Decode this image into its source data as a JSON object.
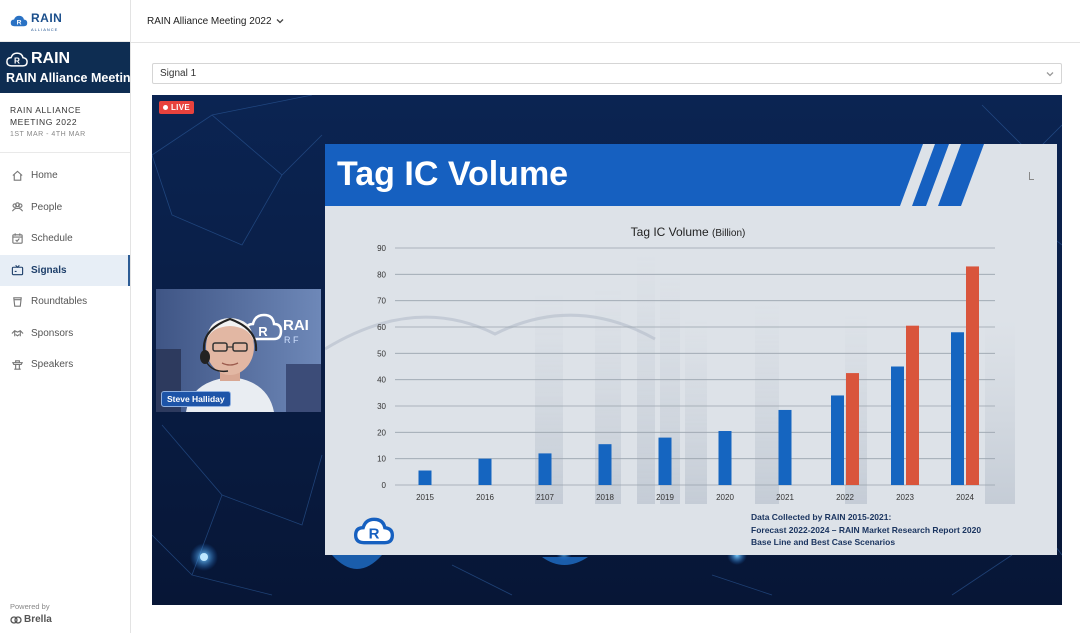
{
  "brand": {
    "logo_word": "RAIN",
    "logo_sub": "ALLIANCE",
    "banner_title": "RAIN Alliance Meeting"
  },
  "event": {
    "name": "RAIN ALLIANCE MEETING 2022",
    "dates": "1ST MAR - 4TH MAR"
  },
  "nav": [
    {
      "label": "Home",
      "icon": "home-icon"
    },
    {
      "label": "People",
      "icon": "people-icon"
    },
    {
      "label": "Schedule",
      "icon": "calendar-icon"
    },
    {
      "label": "Signals",
      "icon": "tv-icon",
      "active": true
    },
    {
      "label": "Roundtables",
      "icon": "cup-icon"
    },
    {
      "label": "Sponsors",
      "icon": "handshake-icon"
    },
    {
      "label": "Speakers",
      "icon": "podium-icon"
    }
  ],
  "powered": {
    "label": "Powered by",
    "brand": "Brella"
  },
  "topbar": {
    "event_title": "RAIN Alliance Meeting 2022"
  },
  "signal": {
    "selected": "Signal 1"
  },
  "video": {
    "live_label": "LIVE",
    "presenter_name": "Steve Halliday",
    "presenter_backdrop_text": "RAI",
    "presenter_backdrop_sub": "R F"
  },
  "slide": {
    "title": "Tag IC Volume",
    "chart_title": "Tag IC Volume",
    "chart_title_unit": "(Billion)",
    "footnote": [
      "Data Collected by RAIN 2015-2021:",
      "Forecast 2022-2024 – RAIN Market Research Report 2020",
      "Base Line and Best Case Scenarios"
    ]
  },
  "colors": {
    "accent": "#2c5c95",
    "live": "#e8423d",
    "slide_blue": "#1565c0",
    "slide_red": "#d9553c",
    "dark_navy": "#0a1f44"
  },
  "chart_data": {
    "type": "bar",
    "title": "Tag IC Volume (Billion)",
    "categories": [
      "2015",
      "2016",
      "2107",
      "2018",
      "2019",
      "2020",
      "2021",
      "2022",
      "2023",
      "2024"
    ],
    "series": [
      {
        "values": [
          5.5,
          10,
          12,
          15.5,
          18,
          20.5,
          28.5,
          34,
          45,
          58
        ],
        "color": "#1565c0"
      },
      {
        "values": [
          null,
          null,
          null,
          null,
          null,
          null,
          null,
          42.5,
          60.5,
          83
        ],
        "color": "#d9553c"
      }
    ],
    "ylim": [
      0,
      90
    ],
    "yticks": [
      0,
      10,
      20,
      30,
      40,
      50,
      60,
      70,
      80,
      90
    ],
    "grid": true
  }
}
